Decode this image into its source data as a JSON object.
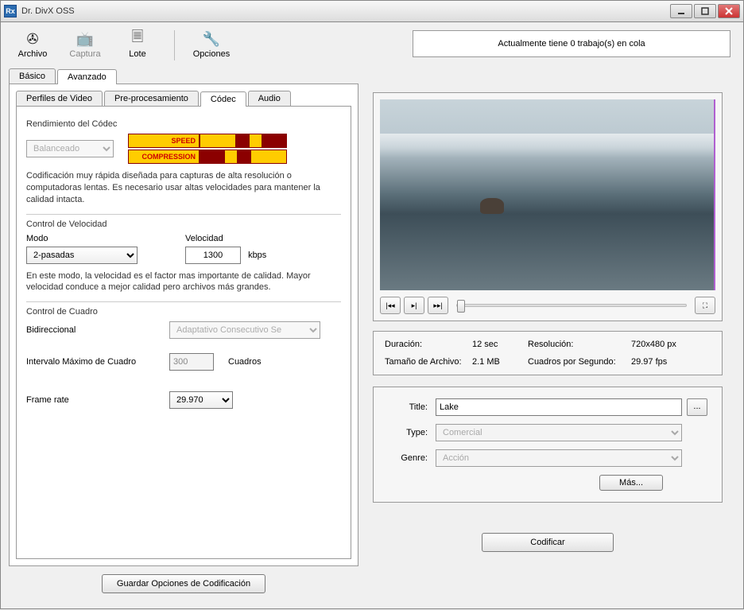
{
  "window": {
    "title": "Dr. DivX OSS"
  },
  "toolbar": {
    "archivo": "Archivo",
    "captura": "Captura",
    "lote": "Lote",
    "opciones": "Opciones",
    "status": "Actualmente tiene 0 trabajo(s) en cola"
  },
  "outer_tabs": {
    "basico": "Básico",
    "avanzado": "Avanzado"
  },
  "inner_tabs": {
    "perfiles": "Perfiles de Video",
    "preproc": "Pre-procesamiento",
    "codec": "Códec",
    "audio": "Audio"
  },
  "codec": {
    "rendimiento_label": "Rendimiento del Códec",
    "preset": "Balanceado",
    "speed_label": "SPEED",
    "compression_label": "COMPRESSION",
    "desc": "Codificación muy rápida diseñada para capturas de alta resolución o computadoras lentas. Es necesario usar altas velocidades para mantener la calidad intacta.",
    "control_velocidad": "Control de Velocidad",
    "modo_label": "Modo",
    "modo_value": "2-pasadas",
    "velocidad_label": "Velocidad",
    "velocidad_value": "1300",
    "velocidad_unit": "kbps",
    "velocidad_desc": "En este modo, la velocidad es el factor mas importante de calidad. Mayor velocidad conduce a mejor calidad pero archivos más grandes.",
    "control_cuadro": "Control de Cuadro",
    "bidireccional_label": "Bidireccional",
    "bidireccional_value": "Adaptativo Consecutivo Se",
    "intervalo_label": "Intervalo Máximo de Cuadro",
    "intervalo_value": "300",
    "intervalo_unit": "Cuadros",
    "framerate_label": "Frame rate",
    "framerate_value": "29.970"
  },
  "buttons": {
    "guardar": "Guardar Opciones de Codificación",
    "codificar": "Codificar",
    "mas": "Más..."
  },
  "info": {
    "duracion_label": "Duración:",
    "duracion_value": "12 sec",
    "resolucion_label": "Resolución:",
    "resolucion_value": "720x480 px",
    "tamano_label": "Tamaño de Archivo:",
    "tamano_value": "2.1 MB",
    "fps_label": "Cuadros por Segundo:",
    "fps_value": "29.97 fps"
  },
  "meta": {
    "title_label": "Title:",
    "title_value": "Lake",
    "type_label": "Type:",
    "type_value": "Comercial",
    "genre_label": "Genre:",
    "genre_value": "Acción"
  }
}
